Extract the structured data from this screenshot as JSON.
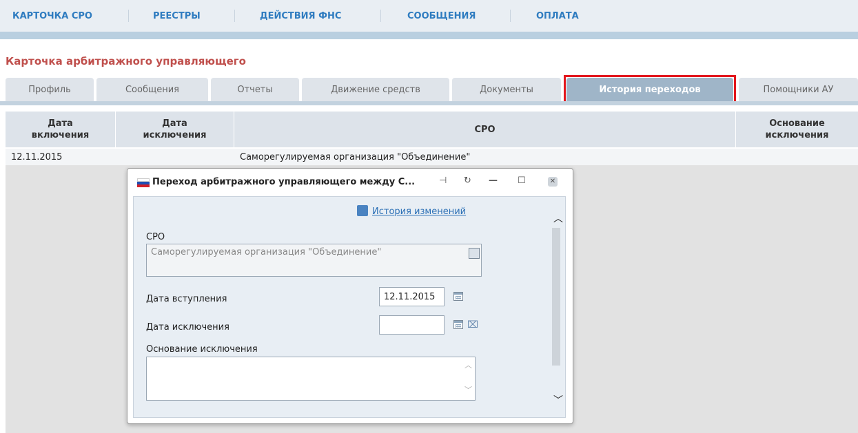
{
  "nav": {
    "items": [
      "КАРТОЧКА СРО",
      "РЕЕСТРЫ",
      "ДЕЙСТВИЯ ФНС",
      "СООБЩЕНИЯ",
      "ОПЛАТА"
    ]
  },
  "page": {
    "title": "Карточка арбитражного управляющего"
  },
  "tabs": [
    "Профиль",
    "Сообщения",
    "Отчеты",
    "Движение средств",
    "Документы",
    "История переходов",
    "Помощники АУ"
  ],
  "active_tab": "История переходов",
  "table": {
    "headers": {
      "date_in_1": "Дата",
      "date_in_2": "включения",
      "date_out_1": "Дата",
      "date_out_2": "исключения",
      "sro": "СРО",
      "reason_1": "Основание",
      "reason_2": "исключения"
    },
    "rows": [
      {
        "date_in": "12.11.2015",
        "date_out": "",
        "sro": "Саморегулируемая организация \"Объединение\"",
        "reason": ""
      }
    ]
  },
  "dialog": {
    "title": "Переход арбитражного управляющего между С...",
    "history_link": "История изменений",
    "sro_label": "СРО",
    "sro_value": "Саморегулируемая организация \"Объединение\"",
    "join_date_label": "Дата вступления",
    "join_date_value": "12.11.2015",
    "exclude_date_label": "Дата исключения",
    "exclude_date_value": "",
    "reason_label": "Основание исключения",
    "reason_value": ""
  },
  "colors": {
    "nav_text": "#2f7cc0",
    "title": "#c0504d",
    "active_tab": "#9fb5c8",
    "highlight": "#e3171d"
  }
}
